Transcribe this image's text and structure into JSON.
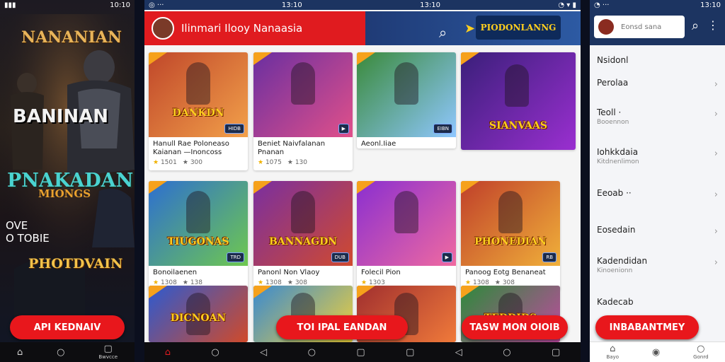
{
  "status": {
    "left_time": "10:10",
    "main_time_a": "13:10",
    "main_time_b": "13:10",
    "right_time": "13:10"
  },
  "left": {
    "title_top": "NANANIAN",
    "title_mid": "BANINAN",
    "title_big": "PNAKADAN",
    "title_sub": "MIONGS",
    "caption1": "OVE",
    "caption2": "O TOBIE",
    "title_bottom": "PHOTDVAIN",
    "cta": "API KEDNAIV",
    "nav_right": "Bwvcce"
  },
  "main": {
    "header_title": "Ilinmari Ilooy Nanaasia",
    "banner_text": "PIODONLANNG",
    "cards": [
      {
        "thumb_title": "DANKDN",
        "caption": "Hanull Rae Poloneaso Kaianan —Inoncoss",
        "rating": "1501",
        "reviews": "300",
        "badge": "HIDB"
      },
      {
        "thumb_title": "",
        "caption": "Beniet Naivfalanan Pnanan",
        "rating": "1075",
        "reviews": "130",
        "badge": "▶"
      },
      {
        "thumb_title": "",
        "caption": "Aeonl.Iiae",
        "rating": "",
        "reviews": "",
        "badge": "EIBN"
      },
      {
        "thumb_title": "SIANVAAS",
        "caption": "",
        "rating": "",
        "reviews": "",
        "badge": ""
      },
      {
        "thumb_title": "TIUGONAS",
        "caption": "Bonoilaenen",
        "rating": "1308",
        "reviews": "138",
        "badge": "TRD"
      },
      {
        "thumb_title": "BANNAGDN",
        "caption": "Panonl Non Vlaoy",
        "rating": "1308",
        "reviews": "308",
        "badge": "DUB"
      },
      {
        "thumb_title": "",
        "caption": "Folecil Pion",
        "rating": "1303",
        "reviews": "",
        "badge": "▶"
      },
      {
        "thumb_title": "PHONEDIAN",
        "caption": "Panoog Eotg Benaneat",
        "rating": "1308",
        "reviews": "308",
        "badge": "RB"
      },
      {
        "thumb_title": "DICNOAN",
        "caption": "",
        "rating": "",
        "reviews": "",
        "badge": ""
      },
      {
        "thumb_title": "",
        "caption": "",
        "rating": "",
        "reviews": "",
        "badge": ""
      },
      {
        "thumb_title": "",
        "caption": "",
        "rating": "",
        "reviews": "",
        "badge": ""
      },
      {
        "thumb_title": "TEDDIDS",
        "caption": "",
        "rating": "",
        "reviews": "",
        "badge": ""
      }
    ],
    "cta_center": "TOI IPAL EANDAN",
    "cta_right": "TASW MON OIOIB"
  },
  "right": {
    "search_placeholder": "Eonsd sana",
    "items": [
      {
        "label": "Nsidonl",
        "sub": ""
      },
      {
        "label": "Perolаа",
        "sub": ""
      },
      {
        "label": "Teoll ·",
        "sub": "Booennon"
      },
      {
        "label": "Iohkkdaia",
        "sub": "Kitdnenlimon"
      },
      {
        "label": "Eeoab ··",
        "sub": ""
      },
      {
        "label": "Eosedain",
        "sub": ""
      },
      {
        "label": "Kadendidan",
        "sub": "Kinoenionn"
      },
      {
        "label": "Kadecab",
        "sub": ""
      }
    ],
    "cta": "INBABANTMEY",
    "nav_left": "Bayo",
    "nav_right": "Gonrd"
  }
}
